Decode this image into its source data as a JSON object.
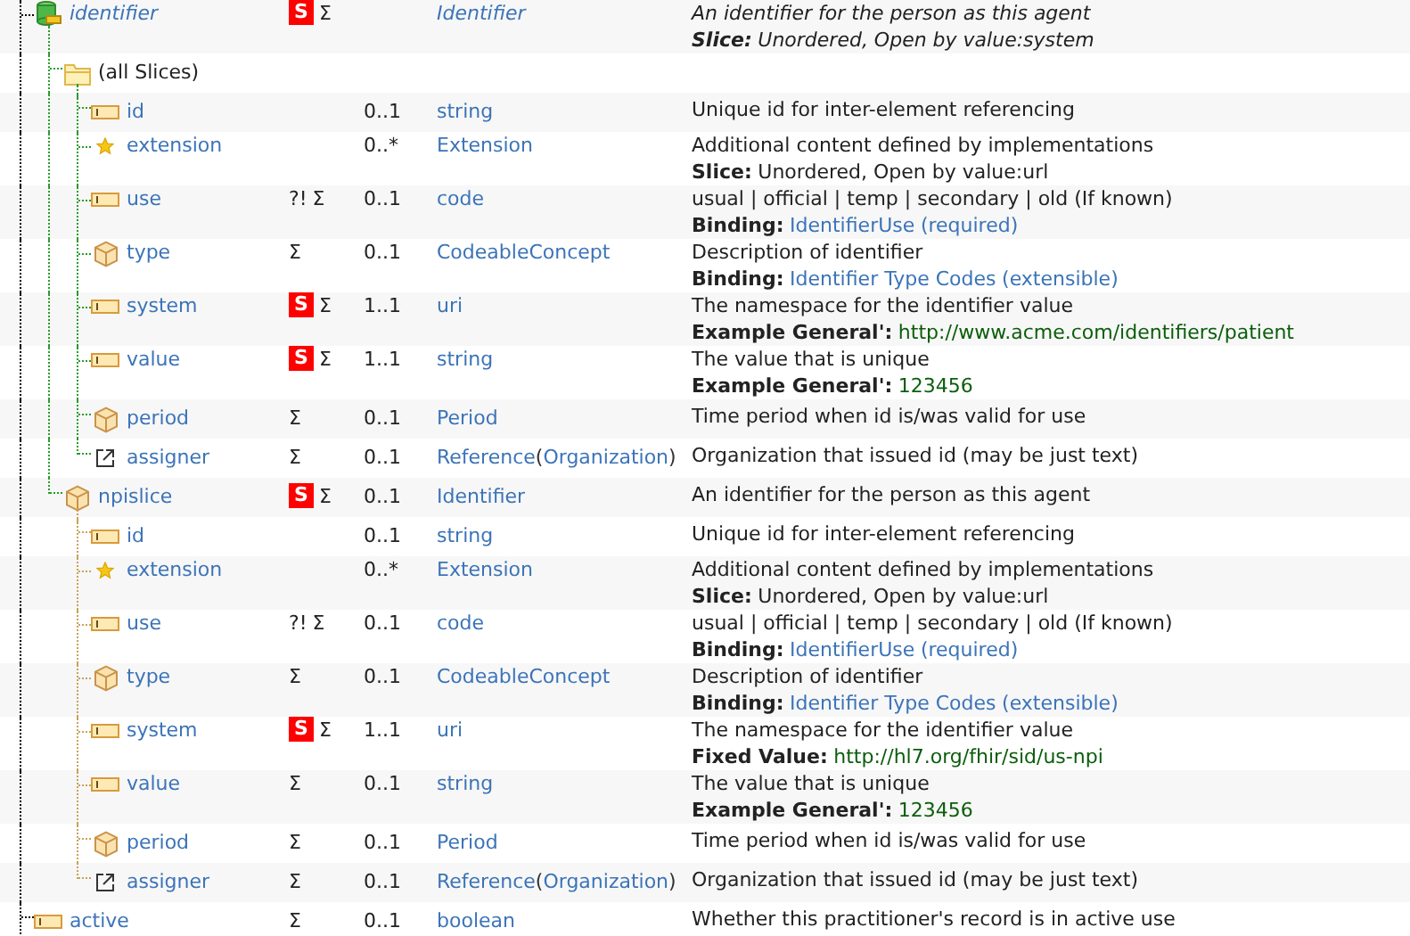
{
  "rows": [
    {
      "name": "identifier",
      "kind": "slice",
      "italic": true,
      "flags": [
        {
          "kind": "badge",
          "text": "S"
        },
        {
          "kind": "plain",
          "text": "Σ"
        }
      ],
      "type": [
        {
          "kind": "link",
          "text": "Identifier"
        }
      ],
      "description": {
        "text": "An identifier for the person as this agent",
        "note": {
          "label": "Slice:",
          "segments": [
            {
              "kind": "text",
              "text": "Unordered, Open by value:system"
            }
          ]
        }
      },
      "children": [
        {
          "name": "(all Slices)",
          "kind": "folder",
          "italic": false,
          "children": [
            {
              "name": "id",
              "kind": "primitive",
              "italic": false,
              "card": "0..1",
              "type": [
                {
                  "kind": "link",
                  "text": "string"
                }
              ],
              "description": {
                "text": "Unique id for inter-element referencing"
              }
            },
            {
              "name": "extension",
              "kind": "extension",
              "italic": false,
              "card": "0..*",
              "type": [
                {
                  "kind": "link",
                  "text": "Extension"
                }
              ],
              "description": {
                "text": "Additional content defined by implementations",
                "note": {
                  "label": "Slice:",
                  "segments": [
                    {
                      "kind": "text",
                      "text": "Unordered, Open by value:url"
                    }
                  ]
                }
              }
            },
            {
              "name": "use",
              "kind": "primitive",
              "italic": false,
              "flags": [
                {
                  "kind": "plain",
                  "text": "?!"
                },
                {
                  "kind": "plain",
                  "text": "Σ"
                }
              ],
              "card": "0..1",
              "type": [
                {
                  "kind": "link",
                  "text": "code"
                }
              ],
              "description": {
                "text": "usual | official | temp | secondary | old (If known)",
                "note": {
                  "label": "Binding:",
                  "segments": [
                    {
                      "kind": "link",
                      "text": "IdentifierUse"
                    },
                    {
                      "kind": "link",
                      "text": "(required)"
                    }
                  ]
                }
              }
            },
            {
              "name": "type",
              "kind": "complex",
              "italic": false,
              "flags": [
                {
                  "kind": "plain",
                  "text": "Σ"
                }
              ],
              "card": "0..1",
              "type": [
                {
                  "kind": "link",
                  "text": "CodeableConcept"
                }
              ],
              "description": {
                "text": "Description of identifier",
                "note": {
                  "label": "Binding:",
                  "segments": [
                    {
                      "kind": "link",
                      "text": "Identifier Type Codes"
                    },
                    {
                      "kind": "link",
                      "text": "(extensible)"
                    }
                  ]
                }
              }
            },
            {
              "name": "system",
              "kind": "primitive",
              "italic": false,
              "flags": [
                {
                  "kind": "badge",
                  "text": "S"
                },
                {
                  "kind": "plain",
                  "text": "Σ"
                }
              ],
              "card": "1..1",
              "type": [
                {
                  "kind": "link",
                  "text": "uri"
                }
              ],
              "description": {
                "text": "The namespace for the identifier value",
                "note": {
                  "label": "Example General':",
                  "segments": [
                    {
                      "kind": "value",
                      "text": "http://www.acme.com/identifiers/patient"
                    }
                  ]
                }
              }
            },
            {
              "name": "value",
              "kind": "primitive",
              "italic": false,
              "flags": [
                {
                  "kind": "badge",
                  "text": "S"
                },
                {
                  "kind": "plain",
                  "text": "Σ"
                }
              ],
              "card": "1..1",
              "type": [
                {
                  "kind": "link",
                  "text": "string"
                }
              ],
              "description": {
                "text": "The value that is unique",
                "note": {
                  "label": "Example General':",
                  "segments": [
                    {
                      "kind": "value",
                      "text": "123456"
                    }
                  ]
                }
              }
            },
            {
              "name": "period",
              "kind": "complex",
              "italic": false,
              "flags": [
                {
                  "kind": "plain",
                  "text": "Σ"
                }
              ],
              "card": "0..1",
              "type": [
                {
                  "kind": "link",
                  "text": "Period"
                }
              ],
              "description": {
                "text": "Time period when id is/was valid for use"
              }
            },
            {
              "name": "assigner",
              "kind": "reference",
              "italic": false,
              "flags": [
                {
                  "kind": "plain",
                  "text": "Σ"
                }
              ],
              "card": "0..1",
              "type": [
                {
                  "kind": "link",
                  "text": "Reference"
                },
                {
                  "kind": "text",
                  "text": "("
                },
                {
                  "kind": "link",
                  "text": "Organization"
                },
                {
                  "kind": "text",
                  "text": ")"
                }
              ],
              "description": {
                "text": "Organization that issued id (may be just text)"
              }
            }
          ]
        },
        {
          "name": "npislice",
          "kind": "complex",
          "italic": false,
          "flags": [
            {
              "kind": "badge",
              "text": "S"
            },
            {
              "kind": "plain",
              "text": "Σ"
            }
          ],
          "card": "0..1",
          "type": [
            {
              "kind": "link",
              "text": "Identifier"
            }
          ],
          "description": {
            "text": "An identifier for the person as this agent"
          },
          "children": [
            {
              "name": "id",
              "kind": "primitive",
              "italic": false,
              "card": "0..1",
              "type": [
                {
                  "kind": "link",
                  "text": "string"
                }
              ],
              "description": {
                "text": "Unique id for inter-element referencing"
              }
            },
            {
              "name": "extension",
              "kind": "extension",
              "italic": false,
              "card": "0..*",
              "type": [
                {
                  "kind": "link",
                  "text": "Extension"
                }
              ],
              "description": {
                "text": "Additional content defined by implementations",
                "note": {
                  "label": "Slice:",
                  "segments": [
                    {
                      "kind": "text",
                      "text": "Unordered, Open by value:url"
                    }
                  ]
                }
              }
            },
            {
              "name": "use",
              "kind": "primitive",
              "italic": false,
              "flags": [
                {
                  "kind": "plain",
                  "text": "?!"
                },
                {
                  "kind": "plain",
                  "text": "Σ"
                }
              ],
              "card": "0..1",
              "type": [
                {
                  "kind": "link",
                  "text": "code"
                }
              ],
              "description": {
                "text": "usual | official | temp | secondary | old (If known)",
                "note": {
                  "label": "Binding:",
                  "segments": [
                    {
                      "kind": "link",
                      "text": "IdentifierUse"
                    },
                    {
                      "kind": "link",
                      "text": "(required)"
                    }
                  ]
                }
              }
            },
            {
              "name": "type",
              "kind": "complex",
              "italic": false,
              "flags": [
                {
                  "kind": "plain",
                  "text": "Σ"
                }
              ],
              "card": "0..1",
              "type": [
                {
                  "kind": "link",
                  "text": "CodeableConcept"
                }
              ],
              "description": {
                "text": "Description of identifier",
                "note": {
                  "label": "Binding:",
                  "segments": [
                    {
                      "kind": "link",
                      "text": "Identifier Type Codes"
                    },
                    {
                      "kind": "link",
                      "text": "(extensible)"
                    }
                  ]
                }
              }
            },
            {
              "name": "system",
              "kind": "primitive",
              "italic": false,
              "flags": [
                {
                  "kind": "badge",
                  "text": "S"
                },
                {
                  "kind": "plain",
                  "text": "Σ"
                }
              ],
              "card": "1..1",
              "type": [
                {
                  "kind": "link",
                  "text": "uri"
                }
              ],
              "description": {
                "text": "The namespace for the identifier value",
                "note": {
                  "label": "Fixed Value:",
                  "segments": [
                    {
                      "kind": "value",
                      "text": "http://hl7.org/fhir/sid/us-npi"
                    }
                  ]
                }
              }
            },
            {
              "name": "value",
              "kind": "primitive",
              "italic": false,
              "flags": [
                {
                  "kind": "plain",
                  "text": "Σ"
                }
              ],
              "card": "0..1",
              "type": [
                {
                  "kind": "link",
                  "text": "string"
                }
              ],
              "description": {
                "text": "The value that is unique",
                "note": {
                  "label": "Example General':",
                  "segments": [
                    {
                      "kind": "value",
                      "text": "123456"
                    }
                  ]
                }
              }
            },
            {
              "name": "period",
              "kind": "complex",
              "italic": false,
              "flags": [
                {
                  "kind": "plain",
                  "text": "Σ"
                }
              ],
              "card": "0..1",
              "type": [
                {
                  "kind": "link",
                  "text": "Period"
                }
              ],
              "description": {
                "text": "Time period when id is/was valid for use"
              }
            },
            {
              "name": "assigner",
              "kind": "reference",
              "italic": false,
              "flags": [
                {
                  "kind": "plain",
                  "text": "Σ"
                }
              ],
              "card": "0..1",
              "type": [
                {
                  "kind": "link",
                  "text": "Reference"
                },
                {
                  "kind": "text",
                  "text": "("
                },
                {
                  "kind": "link",
                  "text": "Organization"
                },
                {
                  "kind": "text",
                  "text": ")"
                }
              ],
              "description": {
                "text": "Organization that issued id (may be just text)"
              }
            }
          ]
        }
      ]
    },
    {
      "name": "active",
      "kind": "primitive",
      "italic": false,
      "flags": [
        {
          "kind": "plain",
          "text": "Σ"
        }
      ],
      "card": "0..1",
      "type": [
        {
          "kind": "link",
          "text": "boolean"
        }
      ],
      "description": {
        "text": "Whether this practitioner's record is in active use"
      }
    }
  ]
}
